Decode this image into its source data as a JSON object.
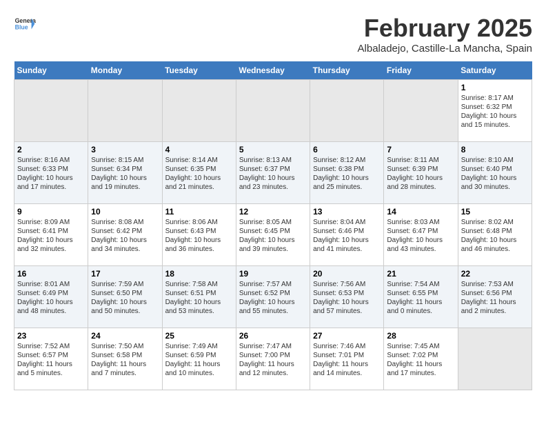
{
  "header": {
    "logo_general": "General",
    "logo_blue": "Blue",
    "title": "February 2025",
    "subtitle": "Albaladejo, Castille-La Mancha, Spain"
  },
  "days_of_week": [
    "Sunday",
    "Monday",
    "Tuesday",
    "Wednesday",
    "Thursday",
    "Friday",
    "Saturday"
  ],
  "weeks": [
    {
      "days": [
        {
          "number": "",
          "info": ""
        },
        {
          "number": "",
          "info": ""
        },
        {
          "number": "",
          "info": ""
        },
        {
          "number": "",
          "info": ""
        },
        {
          "number": "",
          "info": ""
        },
        {
          "number": "",
          "info": ""
        },
        {
          "number": "1",
          "info": "Sunrise: 8:17 AM\nSunset: 6:32 PM\nDaylight: 10 hours\nand 15 minutes."
        }
      ]
    },
    {
      "days": [
        {
          "number": "2",
          "info": "Sunrise: 8:16 AM\nSunset: 6:33 PM\nDaylight: 10 hours\nand 17 minutes."
        },
        {
          "number": "3",
          "info": "Sunrise: 8:15 AM\nSunset: 6:34 PM\nDaylight: 10 hours\nand 19 minutes."
        },
        {
          "number": "4",
          "info": "Sunrise: 8:14 AM\nSunset: 6:35 PM\nDaylight: 10 hours\nand 21 minutes."
        },
        {
          "number": "5",
          "info": "Sunrise: 8:13 AM\nSunset: 6:37 PM\nDaylight: 10 hours\nand 23 minutes."
        },
        {
          "number": "6",
          "info": "Sunrise: 8:12 AM\nSunset: 6:38 PM\nDaylight: 10 hours\nand 25 minutes."
        },
        {
          "number": "7",
          "info": "Sunrise: 8:11 AM\nSunset: 6:39 PM\nDaylight: 10 hours\nand 28 minutes."
        },
        {
          "number": "8",
          "info": "Sunrise: 8:10 AM\nSunset: 6:40 PM\nDaylight: 10 hours\nand 30 minutes."
        }
      ]
    },
    {
      "days": [
        {
          "number": "9",
          "info": "Sunrise: 8:09 AM\nSunset: 6:41 PM\nDaylight: 10 hours\nand 32 minutes."
        },
        {
          "number": "10",
          "info": "Sunrise: 8:08 AM\nSunset: 6:42 PM\nDaylight: 10 hours\nand 34 minutes."
        },
        {
          "number": "11",
          "info": "Sunrise: 8:06 AM\nSunset: 6:43 PM\nDaylight: 10 hours\nand 36 minutes."
        },
        {
          "number": "12",
          "info": "Sunrise: 8:05 AM\nSunset: 6:45 PM\nDaylight: 10 hours\nand 39 minutes."
        },
        {
          "number": "13",
          "info": "Sunrise: 8:04 AM\nSunset: 6:46 PM\nDaylight: 10 hours\nand 41 minutes."
        },
        {
          "number": "14",
          "info": "Sunrise: 8:03 AM\nSunset: 6:47 PM\nDaylight: 10 hours\nand 43 minutes."
        },
        {
          "number": "15",
          "info": "Sunrise: 8:02 AM\nSunset: 6:48 PM\nDaylight: 10 hours\nand 46 minutes."
        }
      ]
    },
    {
      "days": [
        {
          "number": "16",
          "info": "Sunrise: 8:01 AM\nSunset: 6:49 PM\nDaylight: 10 hours\nand 48 minutes."
        },
        {
          "number": "17",
          "info": "Sunrise: 7:59 AM\nSunset: 6:50 PM\nDaylight: 10 hours\nand 50 minutes."
        },
        {
          "number": "18",
          "info": "Sunrise: 7:58 AM\nSunset: 6:51 PM\nDaylight: 10 hours\nand 53 minutes."
        },
        {
          "number": "19",
          "info": "Sunrise: 7:57 AM\nSunset: 6:52 PM\nDaylight: 10 hours\nand 55 minutes."
        },
        {
          "number": "20",
          "info": "Sunrise: 7:56 AM\nSunset: 6:53 PM\nDaylight: 10 hours\nand 57 minutes."
        },
        {
          "number": "21",
          "info": "Sunrise: 7:54 AM\nSunset: 6:55 PM\nDaylight: 11 hours\nand 0 minutes."
        },
        {
          "number": "22",
          "info": "Sunrise: 7:53 AM\nSunset: 6:56 PM\nDaylight: 11 hours\nand 2 minutes."
        }
      ]
    },
    {
      "days": [
        {
          "number": "23",
          "info": "Sunrise: 7:52 AM\nSunset: 6:57 PM\nDaylight: 11 hours\nand 5 minutes."
        },
        {
          "number": "24",
          "info": "Sunrise: 7:50 AM\nSunset: 6:58 PM\nDaylight: 11 hours\nand 7 minutes."
        },
        {
          "number": "25",
          "info": "Sunrise: 7:49 AM\nSunset: 6:59 PM\nDaylight: 11 hours\nand 10 minutes."
        },
        {
          "number": "26",
          "info": "Sunrise: 7:47 AM\nSunset: 7:00 PM\nDaylight: 11 hours\nand 12 minutes."
        },
        {
          "number": "27",
          "info": "Sunrise: 7:46 AM\nSunset: 7:01 PM\nDaylight: 11 hours\nand 14 minutes."
        },
        {
          "number": "28",
          "info": "Sunrise: 7:45 AM\nSunset: 7:02 PM\nDaylight: 11 hours\nand 17 minutes."
        },
        {
          "number": "",
          "info": ""
        }
      ]
    }
  ]
}
